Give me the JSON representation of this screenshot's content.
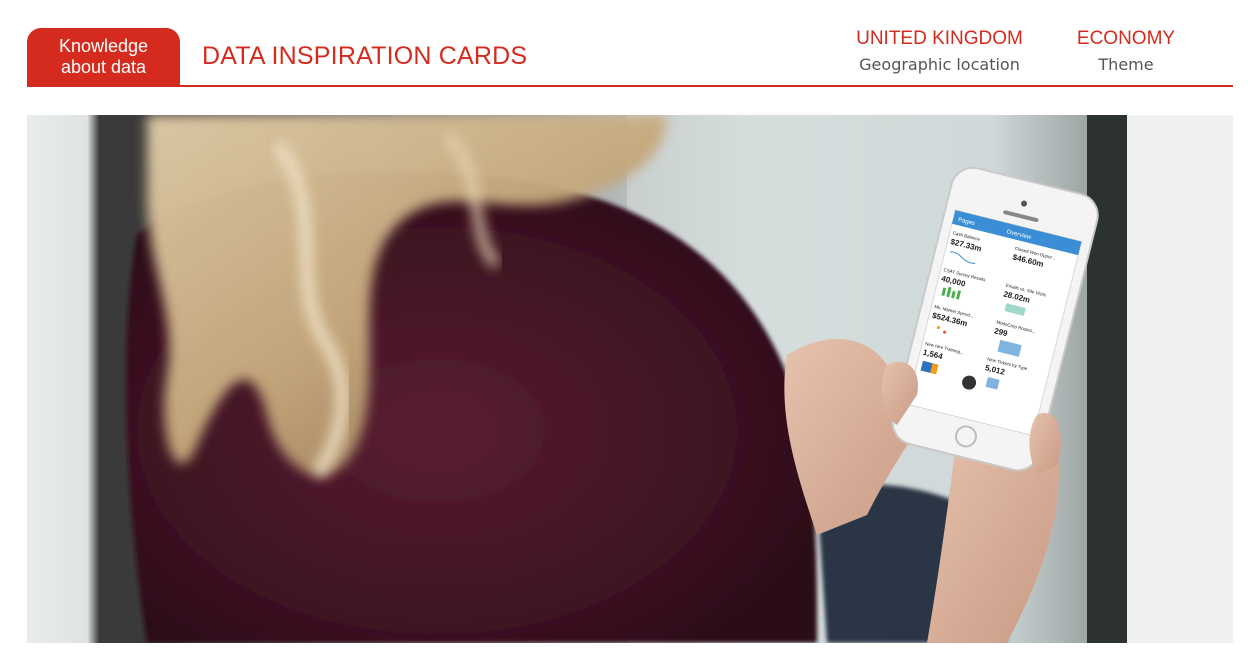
{
  "header": {
    "badge_line1": "Knowledge",
    "badge_line2": "about data",
    "title": "DATA INSPIRATION CARDS",
    "location_value": "UNITED KINGDOM",
    "location_label": "Geographic location",
    "theme_value": "ECONOMY",
    "theme_label": "Theme"
  },
  "colors": {
    "accent": "#d52b1e",
    "label_gray": "#555555"
  },
  "phone_screen": {
    "back_label": "Pages",
    "screen_title": "Overview",
    "tiles": [
      {
        "label": "Cash Balance",
        "value": "$27.33m"
      },
      {
        "label": "Closed Won Oppor...",
        "value": "$46.60m"
      },
      {
        "label": "CSAT Survey Results",
        "value": "40,000"
      },
      {
        "label": "Emails vs. Site Visits",
        "value": "28.02m"
      },
      {
        "label": "Mk. Market Spend...",
        "value": "$524.36m"
      },
      {
        "label": "ModoCorp Routes...",
        "value": "299"
      },
      {
        "label": "New Hire Training...",
        "value": "1,564"
      },
      {
        "label": "New Tickets by Type",
        "value": "5,012"
      }
    ]
  }
}
